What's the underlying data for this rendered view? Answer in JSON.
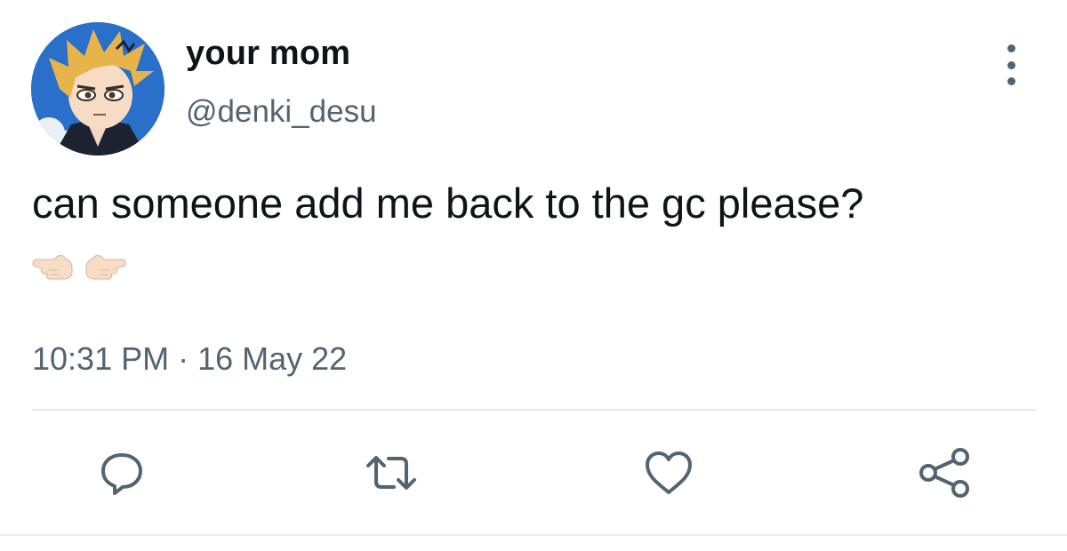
{
  "tweet": {
    "display_name": "your mom",
    "handle": "@denki_desu",
    "text": "can someone add me back to the gc please?",
    "emoji": [
      "finger-pointing-left-emoji",
      "finger-pointing-right-emoji"
    ],
    "timestamp": "10:31 PM · 16 May 22"
  },
  "actions": [
    {
      "name": "reply",
      "icon": "comment-icon"
    },
    {
      "name": "retweet",
      "icon": "retweet-icon"
    },
    {
      "name": "like",
      "icon": "heart-icon"
    },
    {
      "name": "share",
      "icon": "share-icon"
    }
  ],
  "colors": {
    "primary_text": "#0f1419",
    "secondary_text": "#536471",
    "divider": "#e6e9eb",
    "avatar_bg": "#2a6fc9"
  }
}
